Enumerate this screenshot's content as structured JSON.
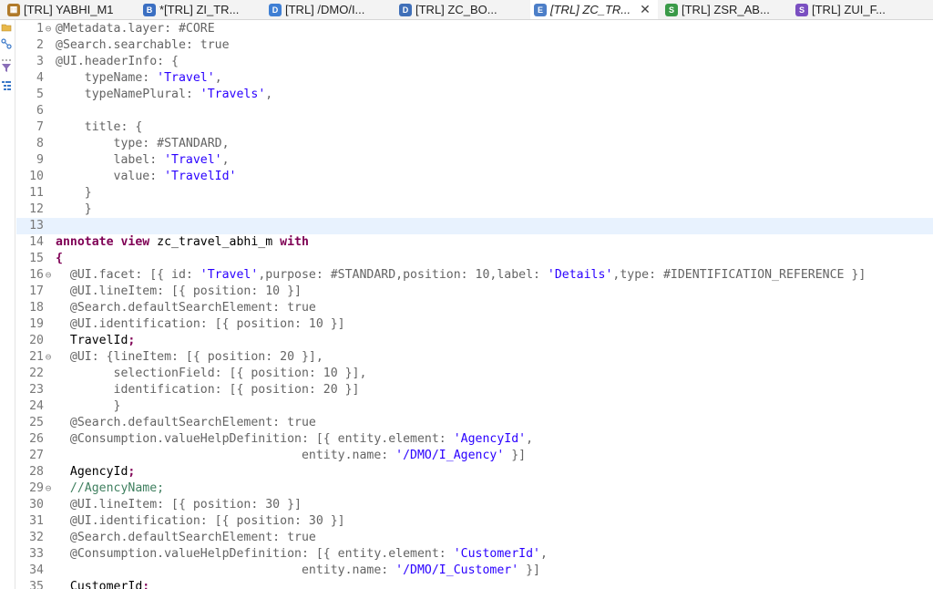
{
  "tabs": [
    {
      "label": "[TRL] YABHI_M1",
      "icon": "table-icon",
      "color": "#b07a2a",
      "glyph": "▦"
    },
    {
      "label": "*[TRL] ZI_TR...",
      "icon": "behavior-definition-icon",
      "color": "#3b6fc2",
      "glyph": "B"
    },
    {
      "label": "[TRL] /DMO/I...",
      "icon": "data-definition-icon",
      "color": "#3f7fd4",
      "glyph": "D"
    },
    {
      "label": "[TRL] ZC_BO...",
      "icon": "data-definition-icon",
      "color": "#3f6fb8",
      "glyph": "D"
    },
    {
      "label": "[TRL] ZC_TR...",
      "icon": "metadata-extension-icon",
      "color": "#4d7fc8",
      "glyph": "E",
      "active": true,
      "close": "✕"
    },
    {
      "label": "[TRL] ZSR_AB...",
      "icon": "service-definition-icon",
      "color": "#3a9a48",
      "glyph": "S"
    },
    {
      "label": "[TRL] ZUI_F...",
      "icon": "service-binding-icon",
      "color": "#7a4fc1",
      "glyph": "S"
    }
  ],
  "editor": {
    "current_line": 13,
    "lines": [
      {
        "n": "1",
        "fold": "⊖",
        "tokens": [
          {
            "t": "@Metadata.layer: #CORE",
            "c": "ann"
          }
        ]
      },
      {
        "n": "2",
        "tokens": [
          {
            "t": "@Search.searchable: true",
            "c": "ann"
          }
        ]
      },
      {
        "n": "3",
        "tokens": [
          {
            "t": "@UI.headerInfo: {",
            "c": "ann"
          }
        ]
      },
      {
        "n": "4",
        "tokens": [
          {
            "t": "    typeName: ",
            "c": "ann"
          },
          {
            "t": "'Travel'",
            "c": "str"
          },
          {
            "t": ",",
            "c": "ann"
          }
        ]
      },
      {
        "n": "5",
        "tokens": [
          {
            "t": "    typeNamePlural: ",
            "c": "ann"
          },
          {
            "t": "'Travels'",
            "c": "str"
          },
          {
            "t": ",",
            "c": "ann"
          }
        ]
      },
      {
        "n": "6",
        "tokens": []
      },
      {
        "n": "7",
        "tokens": [
          {
            "t": "    title: {",
            "c": "ann"
          }
        ]
      },
      {
        "n": "8",
        "tokens": [
          {
            "t": "        type: #STANDARD,",
            "c": "ann"
          }
        ]
      },
      {
        "n": "9",
        "tokens": [
          {
            "t": "        label: ",
            "c": "ann"
          },
          {
            "t": "'Travel'",
            "c": "str"
          },
          {
            "t": ",",
            "c": "ann"
          }
        ]
      },
      {
        "n": "10",
        "tokens": [
          {
            "t": "        value: ",
            "c": "ann"
          },
          {
            "t": "'TravelId'",
            "c": "str"
          }
        ]
      },
      {
        "n": "11",
        "tokens": [
          {
            "t": "    }",
            "c": "ann"
          }
        ]
      },
      {
        "n": "12",
        "tokens": [
          {
            "t": "    }",
            "c": "ann"
          }
        ]
      },
      {
        "n": "13",
        "tokens": []
      },
      {
        "n": "14",
        "tokens": [
          {
            "t": "annotate view",
            "c": "kw"
          },
          {
            "t": " zc_travel_abhi_m ",
            "c": "plain"
          },
          {
            "t": "with",
            "c": "kw"
          }
        ]
      },
      {
        "n": "15",
        "tokens": [
          {
            "t": "{",
            "c": "kw"
          }
        ]
      },
      {
        "n": "16",
        "fold": "⊖",
        "tokens": [
          {
            "t": "  @UI.facet: [{ id: ",
            "c": "ann"
          },
          {
            "t": "'Travel'",
            "c": "str"
          },
          {
            "t": ",purpose: #STANDARD,position: 10,label: ",
            "c": "ann"
          },
          {
            "t": "'Details'",
            "c": "str"
          },
          {
            "t": ",type: #IDENTIFICATION_REFERENCE }]",
            "c": "ann"
          }
        ]
      },
      {
        "n": "17",
        "tokens": [
          {
            "t": "  @UI.lineItem: [{ position: 10 }]",
            "c": "ann"
          }
        ]
      },
      {
        "n": "18",
        "tokens": [
          {
            "t": "  @Search.defaultSearchElement: true",
            "c": "ann"
          }
        ]
      },
      {
        "n": "19",
        "tokens": [
          {
            "t": "  @UI.identification: [{ position: 10 }]",
            "c": "ann"
          }
        ]
      },
      {
        "n": "20",
        "tokens": [
          {
            "t": "  TravelId",
            "c": "plain"
          },
          {
            "t": ";",
            "c": "kw"
          }
        ]
      },
      {
        "n": "21",
        "fold": "⊖",
        "tokens": [
          {
            "t": "  @UI: {lineItem: [{ position: 20 }],",
            "c": "ann"
          }
        ]
      },
      {
        "n": "22",
        "tokens": [
          {
            "t": "        selectionField: [{ position: 10 }],",
            "c": "ann"
          }
        ]
      },
      {
        "n": "23",
        "tokens": [
          {
            "t": "        identification: [{ position: 20 }]",
            "c": "ann"
          }
        ]
      },
      {
        "n": "24",
        "tokens": [
          {
            "t": "        }",
            "c": "ann"
          }
        ]
      },
      {
        "n": "25",
        "tokens": [
          {
            "t": "  @Search.defaultSearchElement: true",
            "c": "ann"
          }
        ]
      },
      {
        "n": "26",
        "tokens": [
          {
            "t": "  @Consumption.valueHelpDefinition: [{ entity.element: ",
            "c": "ann"
          },
          {
            "t": "'AgencyId'",
            "c": "str"
          },
          {
            "t": ",",
            "c": "ann"
          }
        ]
      },
      {
        "n": "27",
        "tokens": [
          {
            "t": "                                  entity.name: ",
            "c": "ann"
          },
          {
            "t": "'/DMO/I_Agency'",
            "c": "str"
          },
          {
            "t": " }]",
            "c": "ann"
          }
        ]
      },
      {
        "n": "28",
        "tokens": [
          {
            "t": "  AgencyId",
            "c": "plain"
          },
          {
            "t": ";",
            "c": "kw"
          }
        ]
      },
      {
        "n": "29",
        "fold": "⊖",
        "tokens": [
          {
            "t": "  //AgencyName;",
            "c": "cmt"
          }
        ]
      },
      {
        "n": "30",
        "tokens": [
          {
            "t": "  @UI.lineItem: [{ position: 30 }]",
            "c": "ann"
          }
        ]
      },
      {
        "n": "31",
        "tokens": [
          {
            "t": "  @UI.identification: [{ position: 30 }]",
            "c": "ann"
          }
        ]
      },
      {
        "n": "32",
        "tokens": [
          {
            "t": "  @Search.defaultSearchElement: true",
            "c": "ann"
          }
        ]
      },
      {
        "n": "33",
        "tokens": [
          {
            "t": "  @Consumption.valueHelpDefinition: [{ entity.element: ",
            "c": "ann"
          },
          {
            "t": "'CustomerId'",
            "c": "str"
          },
          {
            "t": ",",
            "c": "ann"
          }
        ]
      },
      {
        "n": "34",
        "tokens": [
          {
            "t": "                                  entity.name: ",
            "c": "ann"
          },
          {
            "t": "'/DMO/I_Customer'",
            "c": "str"
          },
          {
            "t": " }]",
            "c": "ann"
          }
        ]
      },
      {
        "n": "35",
        "tokens": [
          {
            "t": "  CustomerId",
            "c": "plain"
          },
          {
            "t": ";",
            "c": "kw"
          }
        ]
      }
    ]
  }
}
